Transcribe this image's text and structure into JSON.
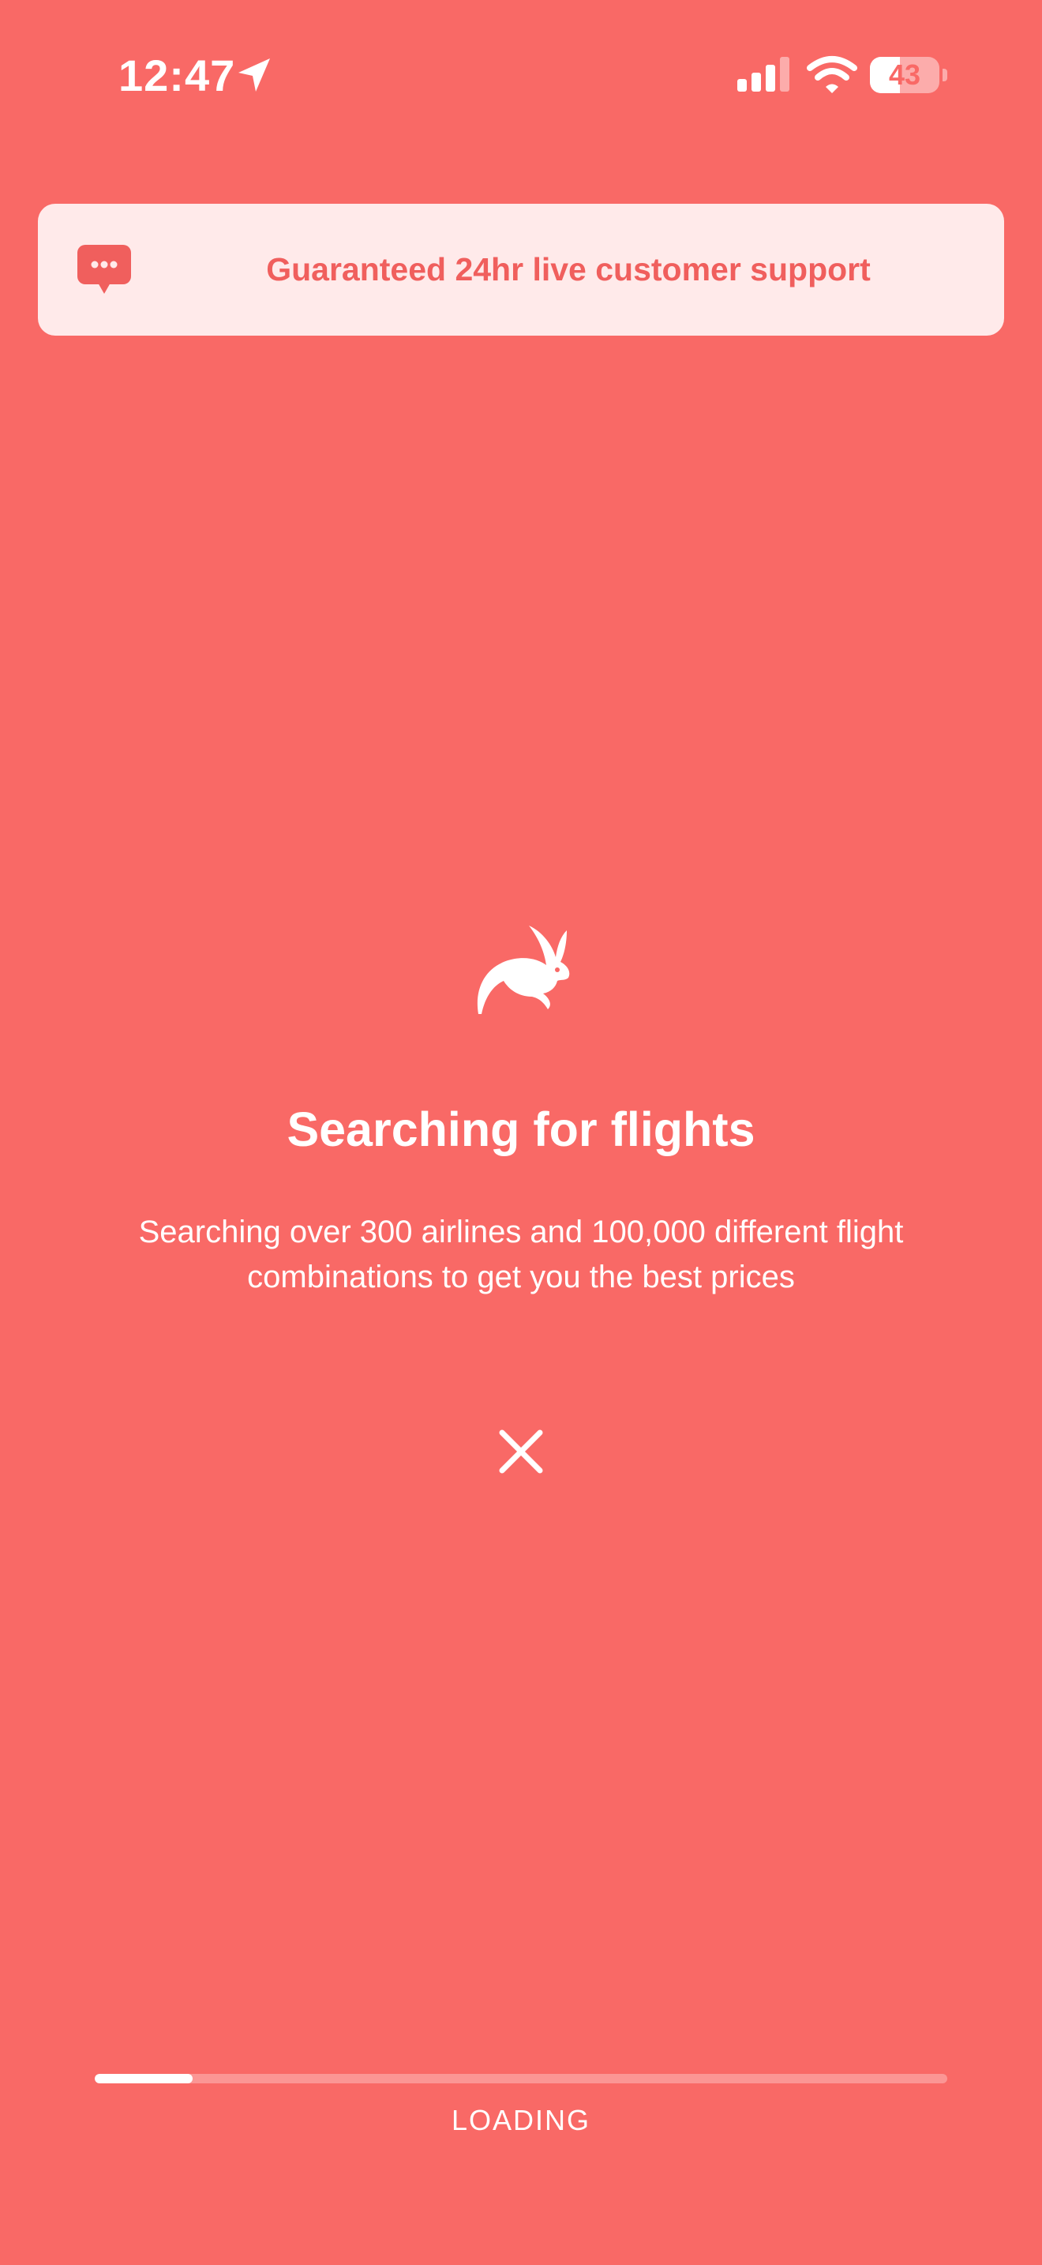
{
  "status_bar": {
    "time": "12:47",
    "battery_level": "43",
    "battery_percent": 43,
    "icons": [
      "location-arrow-icon",
      "cellular-signal-icon",
      "wifi-icon",
      "battery-icon"
    ]
  },
  "support_banner": {
    "icon": "chat-bubble-icon",
    "text": "Guaranteed 24hr live customer support"
  },
  "loading_screen": {
    "icon": "rabbit-icon",
    "title": "Searching for flights",
    "description": "Searching over 300 airlines and 100,000 different flight combinations to get you the best prices",
    "close_icon": "close-icon"
  },
  "progress": {
    "value_percent": 11.5,
    "label": "LOADING"
  },
  "colors": {
    "background": "#F96966",
    "banner_background": "#FFEAEA",
    "accent": "#F05F5D",
    "foreground": "#FFFFFF"
  }
}
